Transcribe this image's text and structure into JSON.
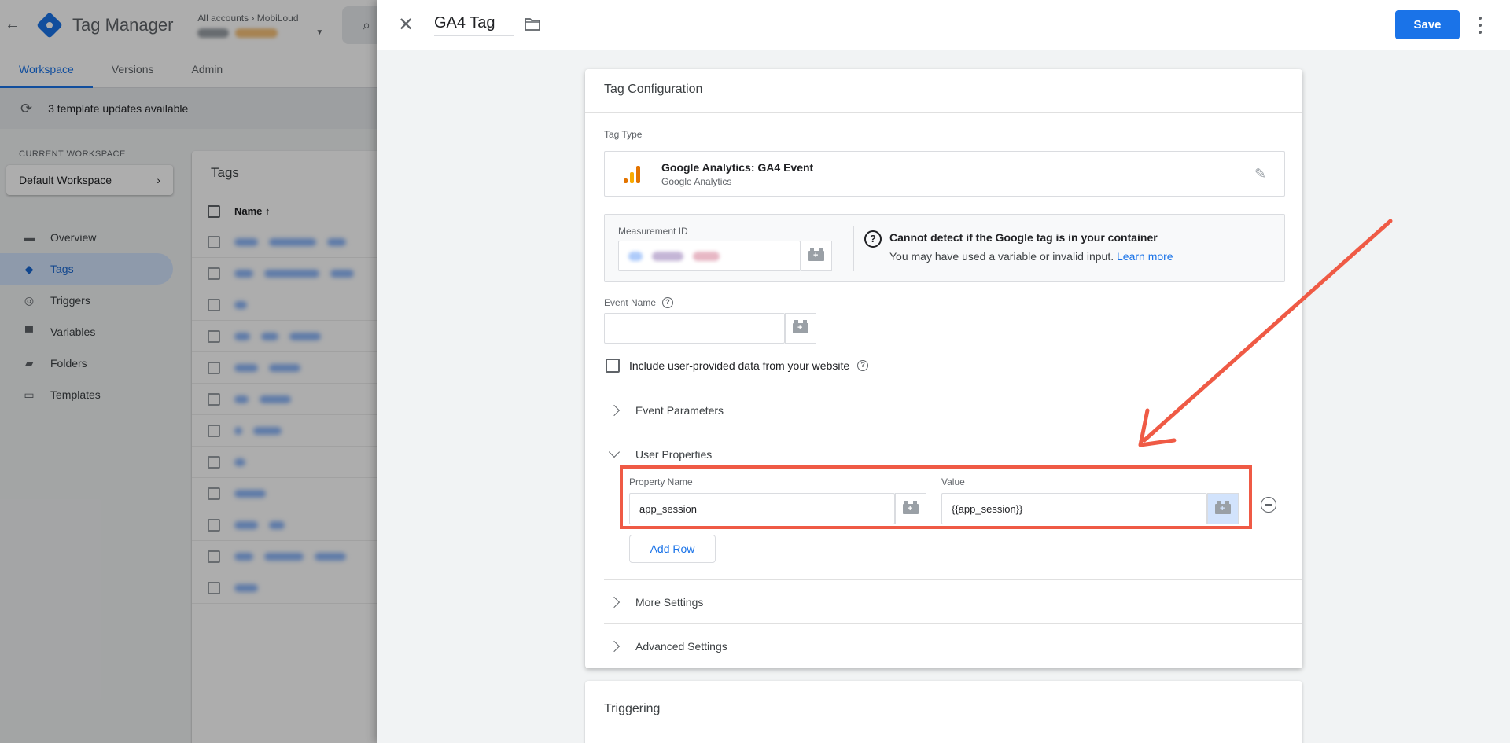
{
  "app": {
    "name": "Tag Manager",
    "account_path": "All accounts › MobiLoud"
  },
  "nav_tabs": [
    {
      "label": "Workspace",
      "active": true
    },
    {
      "label": "Versions",
      "active": false
    },
    {
      "label": "Admin",
      "active": false
    }
  ],
  "updates_banner": "3 template updates available",
  "sidebar": {
    "workspace_label": "CURRENT WORKSPACE",
    "workspace_name": "Default Workspace",
    "items": [
      {
        "label": "Overview",
        "icon": "briefcase-icon"
      },
      {
        "label": "Tags",
        "icon": "tag-icon",
        "active": true
      },
      {
        "label": "Triggers",
        "icon": "trigger-icon"
      },
      {
        "label": "Variables",
        "icon": "variables-icon"
      },
      {
        "label": "Folders",
        "icon": "folder-icon"
      },
      {
        "label": "Templates",
        "icon": "template-icon"
      }
    ]
  },
  "tags_list": {
    "title": "Tags",
    "column_name": "Name ↑"
  },
  "panel": {
    "tag_name": "GA4 Tag",
    "save_label": "Save",
    "config": {
      "title": "Tag Configuration",
      "tag_type_label": "Tag Type",
      "tag_type_name": "Google Analytics: GA4 Event",
      "tag_type_sub": "Google Analytics",
      "measurement_label": "Measurement ID",
      "warning_title": "Cannot detect if the Google tag is in your container",
      "warning_text": "You may have used a variable or invalid input.",
      "warning_link": "Learn more",
      "event_name_label": "Event Name",
      "event_name_value": "",
      "include_label": "Include user-provided data from your website",
      "event_params_label": "Event Parameters",
      "user_props_label": "User Properties",
      "property_name_label": "Property Name",
      "property_name_value": "app_session",
      "value_label": "Value",
      "value_value": "{{app_session}}",
      "add_row_label": "Add Row",
      "more_settings_label": "More Settings",
      "advanced_settings_label": "Advanced Settings"
    },
    "triggering_title": "Triggering"
  },
  "colors": {
    "accent": "#1a73e8",
    "highlight": "#ef5a45",
    "ga_orange": "#f9ab00",
    "ga_dark_orange": "#e37400"
  }
}
